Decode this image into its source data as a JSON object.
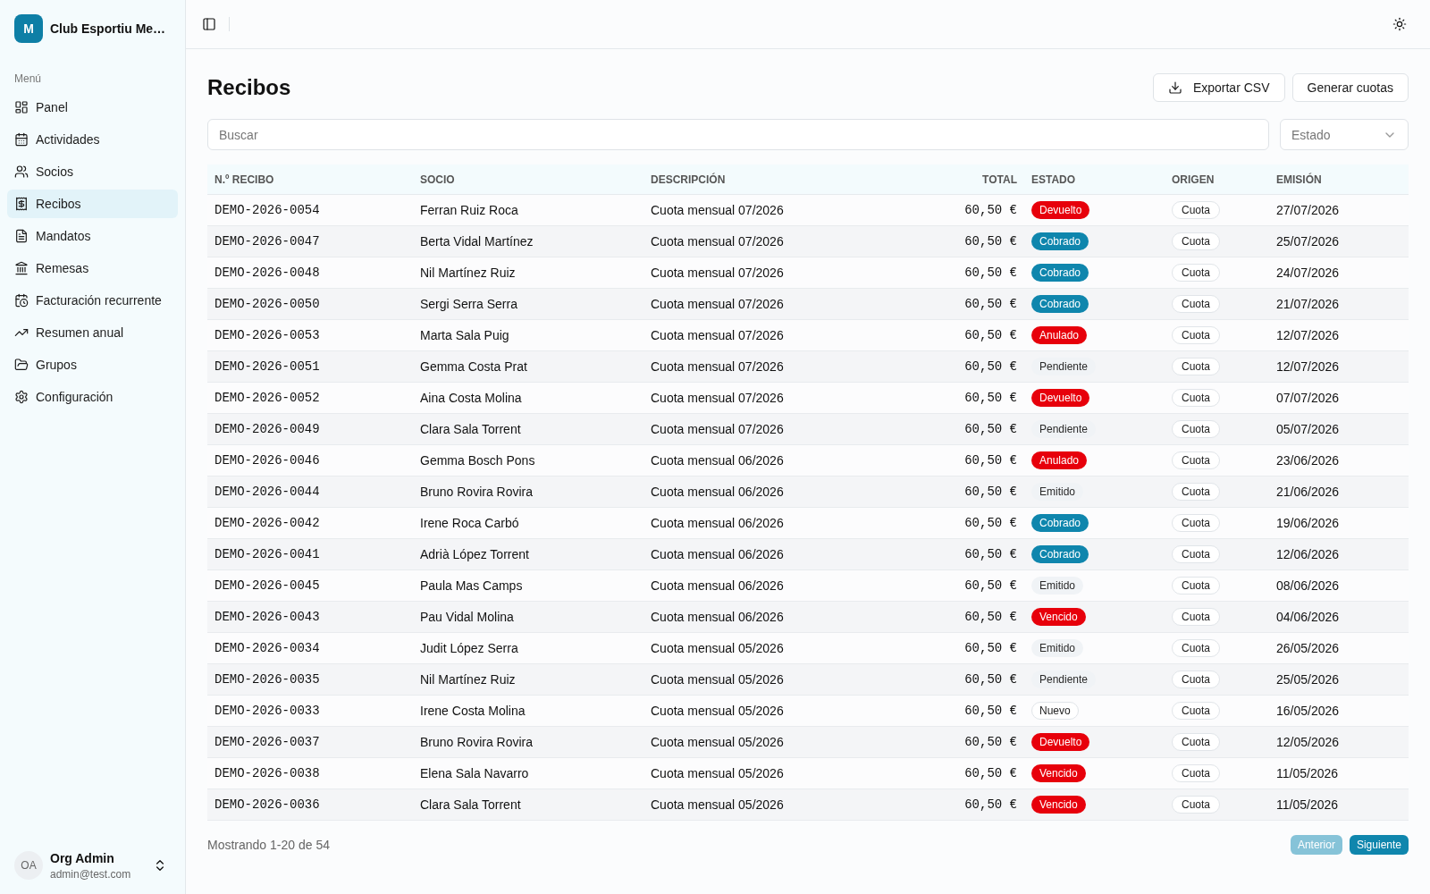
{
  "sidebar": {
    "org": {
      "logo_letter": "M",
      "name": "Club Esportiu Me…"
    },
    "section_label": "Menú",
    "items": [
      {
        "label": "Panel",
        "selected": false
      },
      {
        "label": "Actividades",
        "selected": false
      },
      {
        "label": "Socios",
        "selected": false
      },
      {
        "label": "Recibos",
        "selected": true
      },
      {
        "label": "Mandatos",
        "selected": false
      },
      {
        "label": "Remesas",
        "selected": false
      },
      {
        "label": "Facturación recurrente",
        "selected": false
      },
      {
        "label": "Resumen anual",
        "selected": false
      },
      {
        "label": "Grupos",
        "selected": false
      },
      {
        "label": "Configuración",
        "selected": false
      }
    ],
    "user": {
      "initials": "OA",
      "name": "Org Admin",
      "email": "admin@test.com"
    }
  },
  "page": {
    "title": "Recibos",
    "actions": [
      "Exportar CSV",
      "Generar cuotas"
    ]
  },
  "search": {
    "placeholder": "Buscar"
  },
  "status_filter": {
    "placeholder": "Estado"
  },
  "table": {
    "columns": [
      "N.º RECIBO",
      "SOCIO",
      "DESCRIPCIÓN",
      "TOTAL",
      "ESTADO",
      "ORIGEN",
      "EMISIÓN"
    ],
    "rows": [
      {
        "number": "DEMO-2026-0054",
        "member": "Ferran Ruiz Roca",
        "description": "Cuota mensual 07/2026",
        "total": "60,50 €",
        "status": {
          "label": "Devuelto",
          "kind": "danger"
        },
        "origin": "Cuota",
        "issued": "27/07/2026"
      },
      {
        "number": "DEMO-2026-0047",
        "member": "Berta Vidal Martínez",
        "description": "Cuota mensual 07/2026",
        "total": "60,50 €",
        "status": {
          "label": "Cobrado",
          "kind": "primary"
        },
        "origin": "Cuota",
        "issued": "25/07/2026"
      },
      {
        "number": "DEMO-2026-0048",
        "member": "Nil Martínez Ruiz",
        "description": "Cuota mensual 07/2026",
        "total": "60,50 €",
        "status": {
          "label": "Cobrado",
          "kind": "primary"
        },
        "origin": "Cuota",
        "issued": "24/07/2026"
      },
      {
        "number": "DEMO-2026-0050",
        "member": "Sergi Serra Serra",
        "description": "Cuota mensual 07/2026",
        "total": "60,50 €",
        "status": {
          "label": "Cobrado",
          "kind": "primary"
        },
        "origin": "Cuota",
        "issued": "21/07/2026"
      },
      {
        "number": "DEMO-2026-0053",
        "member": "Marta Sala Puig",
        "description": "Cuota mensual 07/2026",
        "total": "60,50 €",
        "status": {
          "label": "Anulado",
          "kind": "danger"
        },
        "origin": "Cuota",
        "issued": "12/07/2026"
      },
      {
        "number": "DEMO-2026-0051",
        "member": "Gemma Costa Prat",
        "description": "Cuota mensual 07/2026",
        "total": "60,50 €",
        "status": {
          "label": "Pendiente",
          "kind": "secondary"
        },
        "origin": "Cuota",
        "issued": "12/07/2026"
      },
      {
        "number": "DEMO-2026-0052",
        "member": "Aina Costa Molina",
        "description": "Cuota mensual 07/2026",
        "total": "60,50 €",
        "status": {
          "label": "Devuelto",
          "kind": "danger"
        },
        "origin": "Cuota",
        "issued": "07/07/2026"
      },
      {
        "number": "DEMO-2026-0049",
        "member": "Clara Sala Torrent",
        "description": "Cuota mensual 07/2026",
        "total": "60,50 €",
        "status": {
          "label": "Pendiente",
          "kind": "secondary"
        },
        "origin": "Cuota",
        "issued": "05/07/2026"
      },
      {
        "number": "DEMO-2026-0046",
        "member": "Gemma Bosch Pons",
        "description": "Cuota mensual 06/2026",
        "total": "60,50 €",
        "status": {
          "label": "Anulado",
          "kind": "danger"
        },
        "origin": "Cuota",
        "issued": "23/06/2026"
      },
      {
        "number": "DEMO-2026-0044",
        "member": "Bruno Rovira Rovira",
        "description": "Cuota mensual 06/2026",
        "total": "60,50 €",
        "status": {
          "label": "Emitido",
          "kind": "secondary"
        },
        "origin": "Cuota",
        "issued": "21/06/2026"
      },
      {
        "number": "DEMO-2026-0042",
        "member": "Irene Roca Carbó",
        "description": "Cuota mensual 06/2026",
        "total": "60,50 €",
        "status": {
          "label": "Cobrado",
          "kind": "primary"
        },
        "origin": "Cuota",
        "issued": "19/06/2026"
      },
      {
        "number": "DEMO-2026-0041",
        "member": "Adrià López Torrent",
        "description": "Cuota mensual 06/2026",
        "total": "60,50 €",
        "status": {
          "label": "Cobrado",
          "kind": "primary"
        },
        "origin": "Cuota",
        "issued": "12/06/2026"
      },
      {
        "number": "DEMO-2026-0045",
        "member": "Paula Mas Camps",
        "description": "Cuota mensual 06/2026",
        "total": "60,50 €",
        "status": {
          "label": "Emitido",
          "kind": "secondary"
        },
        "origin": "Cuota",
        "issued": "08/06/2026"
      },
      {
        "number": "DEMO-2026-0043",
        "member": "Pau Vidal Molina",
        "description": "Cuota mensual 06/2026",
        "total": "60,50 €",
        "status": {
          "label": "Vencido",
          "kind": "danger"
        },
        "origin": "Cuota",
        "issued": "04/06/2026"
      },
      {
        "number": "DEMO-2026-0034",
        "member": "Judit López Serra",
        "description": "Cuota mensual 05/2026",
        "total": "60,50 €",
        "status": {
          "label": "Emitido",
          "kind": "secondary"
        },
        "origin": "Cuota",
        "issued": "26/05/2026"
      },
      {
        "number": "DEMO-2026-0035",
        "member": "Nil Martínez Ruiz",
        "description": "Cuota mensual 05/2026",
        "total": "60,50 €",
        "status": {
          "label": "Pendiente",
          "kind": "secondary"
        },
        "origin": "Cuota",
        "issued": "25/05/2026"
      },
      {
        "number": "DEMO-2026-0033",
        "member": "Irene Costa Molina",
        "description": "Cuota mensual 05/2026",
        "total": "60,50 €",
        "status": {
          "label": "Nuevo",
          "kind": "outline"
        },
        "origin": "Cuota",
        "issued": "16/05/2026"
      },
      {
        "number": "DEMO-2026-0037",
        "member": "Bruno Rovira Rovira",
        "description": "Cuota mensual 05/2026",
        "total": "60,50 €",
        "status": {
          "label": "Devuelto",
          "kind": "danger"
        },
        "origin": "Cuota",
        "issued": "12/05/2026"
      },
      {
        "number": "DEMO-2026-0038",
        "member": "Elena Sala Navarro",
        "description": "Cuota mensual 05/2026",
        "total": "60,50 €",
        "status": {
          "label": "Vencido",
          "kind": "danger"
        },
        "origin": "Cuota",
        "issued": "11/05/2026"
      },
      {
        "number": "DEMO-2026-0036",
        "member": "Clara Sala Torrent",
        "description": "Cuota mensual 05/2026",
        "total": "60,50 €",
        "status": {
          "label": "Vencido",
          "kind": "danger"
        },
        "origin": "Cuota",
        "issued": "11/05/2026"
      }
    ]
  },
  "footer": {
    "summary": "Mostrando 1-20 de 54",
    "pagination": [
      {
        "label": "Anterior",
        "disabled": true
      },
      {
        "label": "Siguiente",
        "disabled": false
      }
    ]
  }
}
